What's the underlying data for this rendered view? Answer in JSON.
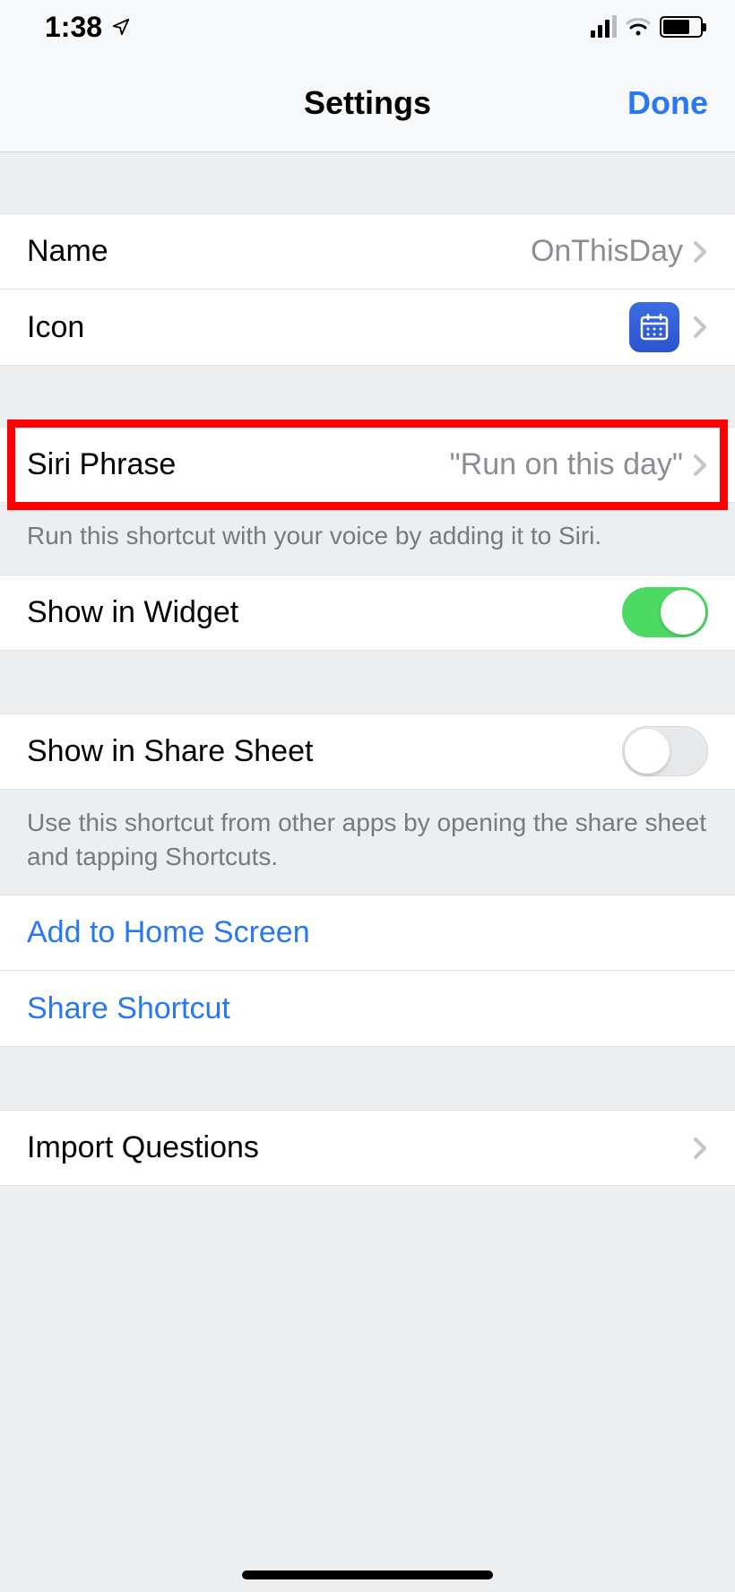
{
  "status": {
    "time": "1:38"
  },
  "nav": {
    "title": "Settings",
    "done": "Done"
  },
  "rows": {
    "name": {
      "label": "Name",
      "value": "OnThisDay"
    },
    "icon": {
      "label": "Icon"
    },
    "siri": {
      "label": "Siri Phrase",
      "value": "\"Run on this day\""
    },
    "widget": {
      "label": "Show in Widget",
      "on": true
    },
    "share_sheet": {
      "label": "Show in Share Sheet",
      "on": false
    },
    "add_home": {
      "label": "Add to Home Screen"
    },
    "share_shortcut": {
      "label": "Share Shortcut"
    },
    "import_q": {
      "label": "Import Questions"
    }
  },
  "footers": {
    "siri": "Run this shortcut with your voice by adding it to Siri.",
    "share_sheet": "Use this shortcut from other apps by opening the share sheet and tapping Shortcuts."
  }
}
